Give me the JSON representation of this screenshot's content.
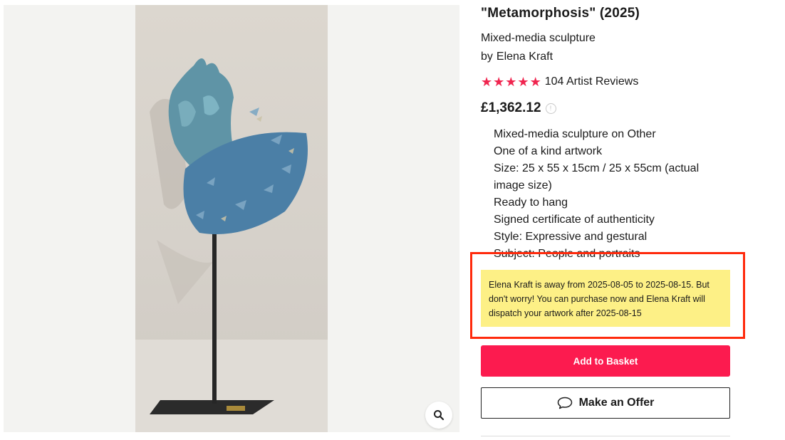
{
  "artwork": {
    "title": "\"Metamorphosis\" (2025)",
    "subtitle": "Mixed-media sculpture",
    "artist_prefix": "by",
    "artist_name": "Elena Kraft",
    "rating": {
      "stars": 5,
      "reviews_text": "104 Artist Reviews"
    },
    "price": "£1,362.12",
    "features": [
      "Mixed-media sculpture on Other",
      "One of a kind artwork",
      "Size: 25 x 55 x 15cm / 25 x 55cm (actual image size)",
      "Ready to hang",
      "Signed certificate of authenticity",
      "Style: Expressive and gestural",
      "Subject: People and portraits"
    ]
  },
  "notice": {
    "away_message": "Elena Kraft is away from 2025-08-05 to 2025-08-15. But don't worry! You can purchase now and Elena Kraft will dispatch your artwork after 2025-08-15"
  },
  "actions": {
    "add_to_basket": "Add to Basket",
    "make_offer": "Make an Offer"
  },
  "icons": {
    "zoom": "magnifier-icon",
    "info": "info-icon",
    "offer": "speech-bubble-icon",
    "star": "star-icon"
  },
  "colors": {
    "accent": "#fc1b4f",
    "star": "#f0254f",
    "notice_bg": "#fdf086",
    "highlight_frame": "#ff2a0c"
  }
}
